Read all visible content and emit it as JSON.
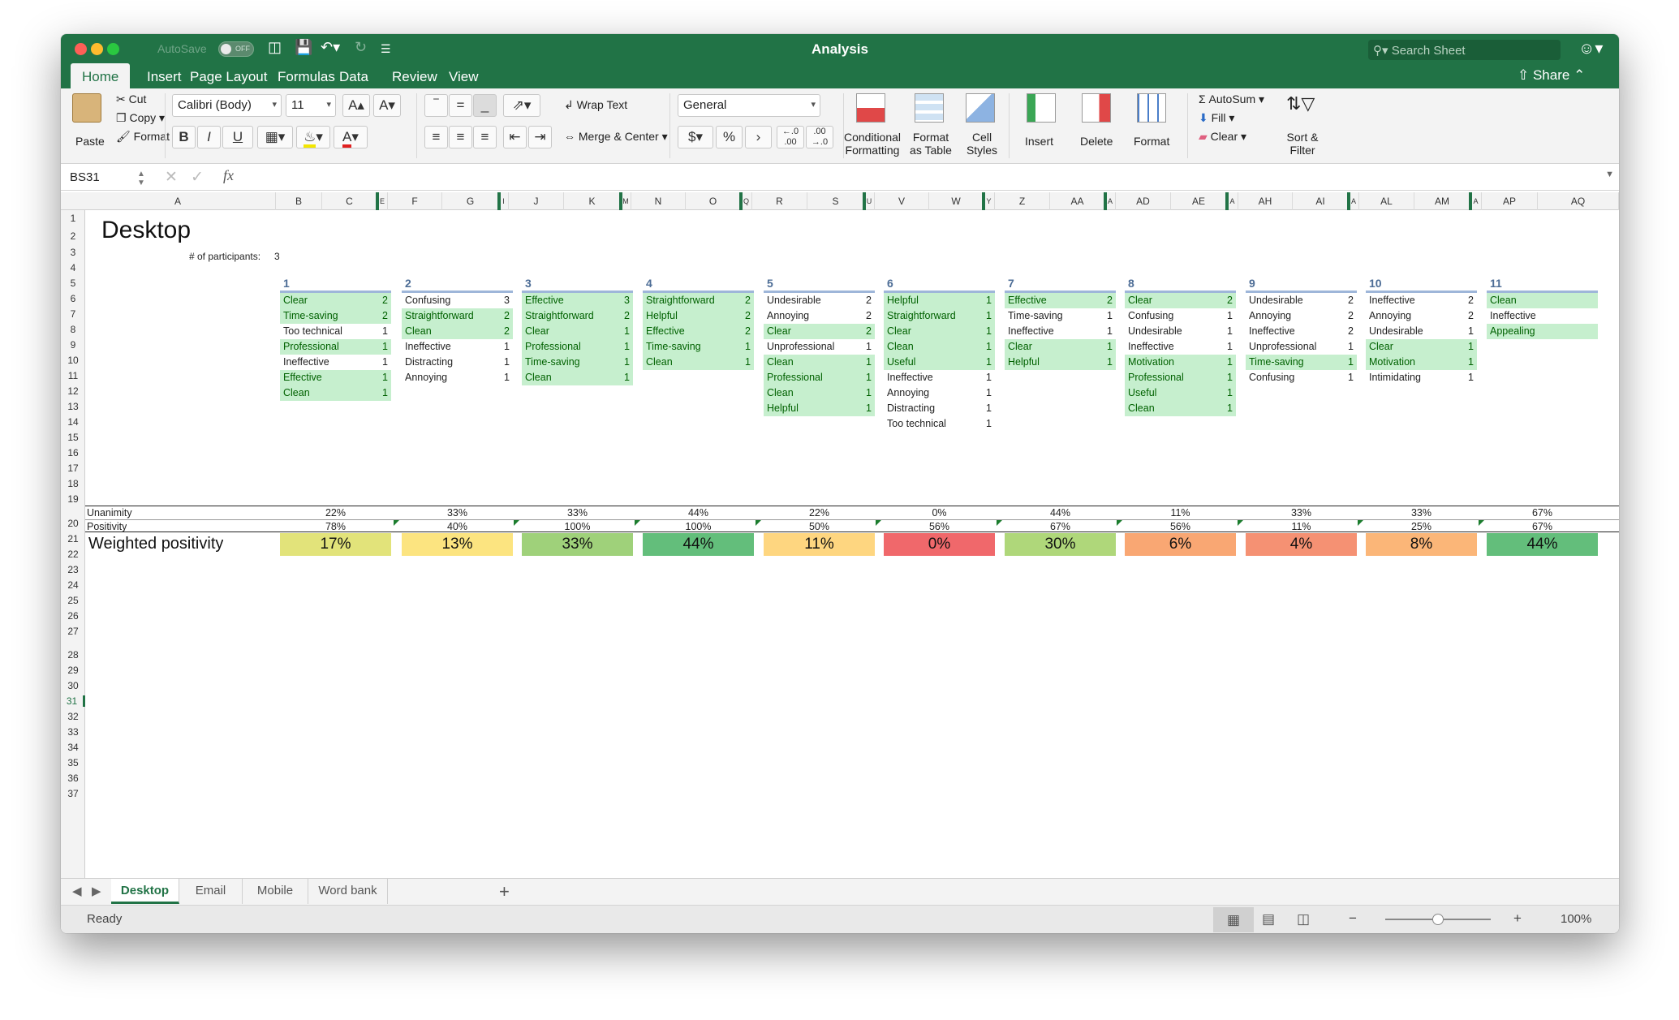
{
  "window": {
    "title": "Analysis",
    "autosave_label": "AutoSave",
    "autosave_state": "OFF",
    "search_placeholder": "Search Sheet",
    "share_label": "Share"
  },
  "ribbon": {
    "tabs": [
      "Home",
      "Insert",
      "Page Layout",
      "Formulas",
      "Data",
      "Review",
      "View"
    ],
    "active_tab": "Home",
    "clipboard": {
      "paste": "Paste",
      "cut": "Cut",
      "copy": "Copy",
      "format": "Format"
    },
    "font": {
      "name": "Calibri (Body)",
      "size": "11",
      "bold": "B",
      "italic": "I",
      "underline": "U"
    },
    "alignment": {
      "wrap_text": "Wrap Text",
      "merge_center": "Merge & Center"
    },
    "number": {
      "format": "General",
      "currency": "$",
      "percent": "%",
      "comma": "›",
      "inc_decimal": "←.0 .00",
      "dec_decimal": ".00 →.0"
    },
    "styles": {
      "conditional": "Conditional Formatting",
      "format_table": "Format as Table",
      "cell_styles": "Cell Styles"
    },
    "cells": {
      "insert": "Insert",
      "delete": "Delete",
      "format": "Format"
    },
    "editing": {
      "autosum": "AutoSum",
      "fill": "Fill",
      "clear": "Clear",
      "sort_filter": "Sort & Filter"
    }
  },
  "formula_bar": {
    "name_box": "BS31",
    "fx": "fx",
    "content": ""
  },
  "columns": [
    "A",
    "B",
    "C",
    "E",
    "F",
    "G",
    "I",
    "J",
    "K",
    "M",
    "N",
    "O",
    "Q",
    "R",
    "S",
    "U",
    "V",
    "W",
    "Y",
    "Z",
    "AA",
    "A",
    "AD",
    "AE",
    "A",
    "AH",
    "AI",
    "A",
    "AL",
    "AM",
    "A",
    "AP",
    "AQ"
  ],
  "rows": [
    "1",
    "2",
    "3",
    "4",
    "5",
    "6",
    "7",
    "8",
    "9",
    "10",
    "11",
    "12",
    "13",
    "14",
    "15",
    "16",
    "17",
    "18",
    "19",
    "20",
    "21",
    "22",
    "23",
    "24",
    "25",
    "26",
    "27",
    "28",
    "29",
    "30",
    "31",
    "32",
    "33",
    "34",
    "35",
    "36",
    "37"
  ],
  "selected_row": "31",
  "sheet": {
    "title": "Desktop",
    "participants_label": "# of participants:",
    "participants_value": "3",
    "unanimity_label": "Unanimity",
    "positivity_label": "Positivity",
    "weighted_label": "Weighted positivity",
    "blocks": [
      {
        "num": "1",
        "words": [
          {
            "w": "Clear",
            "n": "2",
            "pos": true
          },
          {
            "w": "Time-saving",
            "n": "2",
            "pos": true
          },
          {
            "w": "Too technical",
            "n": "1",
            "pos": false
          },
          {
            "w": "Professional",
            "n": "1",
            "pos": true
          },
          {
            "w": "Ineffective",
            "n": "1",
            "pos": false
          },
          {
            "w": "Effective",
            "n": "1",
            "pos": true
          },
          {
            "w": "Clean",
            "n": "1",
            "pos": true
          }
        ],
        "unanimity": "22%",
        "positivity": "78%",
        "weighted": "17%",
        "color": "#e2e37a"
      },
      {
        "num": "2",
        "words": [
          {
            "w": "Confusing",
            "n": "3",
            "pos": false
          },
          {
            "w": "Straightforward",
            "n": "2",
            "pos": true
          },
          {
            "w": "Clean",
            "n": "2",
            "pos": true
          },
          {
            "w": "Ineffective",
            "n": "1",
            "pos": false
          },
          {
            "w": "Distracting",
            "n": "1",
            "pos": false
          },
          {
            "w": "Annoying",
            "n": "1",
            "pos": false
          }
        ],
        "unanimity": "33%",
        "positivity": "40%",
        "weighted": "13%",
        "color": "#fce480"
      },
      {
        "num": "3",
        "words": [
          {
            "w": "Effective",
            "n": "3",
            "pos": true
          },
          {
            "w": "Straightforward",
            "n": "2",
            "pos": true
          },
          {
            "w": "Clear",
            "n": "1",
            "pos": true
          },
          {
            "w": "Professional",
            "n": "1",
            "pos": true
          },
          {
            "w": "Time-saving",
            "n": "1",
            "pos": true
          },
          {
            "w": "Clean",
            "n": "1",
            "pos": true
          }
        ],
        "unanimity": "33%",
        "positivity": "100%",
        "weighted": "33%",
        "color": "#9fd17a"
      },
      {
        "num": "4",
        "words": [
          {
            "w": "Straightforward",
            "n": "2",
            "pos": true
          },
          {
            "w": "Helpful",
            "n": "2",
            "pos": true
          },
          {
            "w": "Effective",
            "n": "2",
            "pos": true
          },
          {
            "w": "Time-saving",
            "n": "1",
            "pos": true
          },
          {
            "w": "Clean",
            "n": "1",
            "pos": true
          }
        ],
        "unanimity": "44%",
        "positivity": "100%",
        "weighted": "44%",
        "color": "#63be7b"
      },
      {
        "num": "5",
        "words": [
          {
            "w": "Undesirable",
            "n": "2",
            "pos": false
          },
          {
            "w": "Annoying",
            "n": "2",
            "pos": false
          },
          {
            "w": "Clear",
            "n": "2",
            "pos": true
          },
          {
            "w": "Unprofessional",
            "n": "1",
            "pos": false
          },
          {
            "w": "Clean",
            "n": "1",
            "pos": true
          },
          {
            "w": "Professional",
            "n": "1",
            "pos": true
          },
          {
            "w": "Clean",
            "n": "1",
            "pos": true
          },
          {
            "w": "Helpful",
            "n": "1",
            "pos": true
          }
        ],
        "unanimity": "22%",
        "positivity": "50%",
        "weighted": "11%",
        "color": "#fed680"
      },
      {
        "num": "6",
        "words": [
          {
            "w": "Helpful",
            "n": "1",
            "pos": true
          },
          {
            "w": "Straightforward",
            "n": "1",
            "pos": true
          },
          {
            "w": "Clear",
            "n": "1",
            "pos": true
          },
          {
            "w": "Clean",
            "n": "1",
            "pos": true
          },
          {
            "w": "Useful",
            "n": "1",
            "pos": true
          },
          {
            "w": "Ineffective",
            "n": "1",
            "pos": false
          },
          {
            "w": "Annoying",
            "n": "1",
            "pos": false
          },
          {
            "w": "Distracting",
            "n": "1",
            "pos": false
          },
          {
            "w": "Too technical",
            "n": "1",
            "pos": false
          }
        ],
        "unanimity": "0%",
        "positivity": "56%",
        "weighted": "0%",
        "color": "#f0686b"
      },
      {
        "num": "7",
        "words": [
          {
            "w": "Effective",
            "n": "2",
            "pos": true
          },
          {
            "w": "Time-saving",
            "n": "1",
            "pos": false
          },
          {
            "w": "Ineffective",
            "n": "1",
            "pos": false
          },
          {
            "w": "Clear",
            "n": "1",
            "pos": true
          },
          {
            "w": "Helpful",
            "n": "1",
            "pos": true
          }
        ],
        "unanimity": "44%",
        "positivity": "67%",
        "weighted": "30%",
        "color": "#afd77a"
      },
      {
        "num": "8",
        "words": [
          {
            "w": "Clear",
            "n": "2",
            "pos": true
          },
          {
            "w": "Confusing",
            "n": "1",
            "pos": false
          },
          {
            "w": "Undesirable",
            "n": "1",
            "pos": false
          },
          {
            "w": "Ineffective",
            "n": "1",
            "pos": false
          },
          {
            "w": "Motivation",
            "n": "1",
            "pos": true
          },
          {
            "w": "Professional",
            "n": "1",
            "pos": true
          },
          {
            "w": "Useful",
            "n": "1",
            "pos": true
          },
          {
            "w": "Clean",
            "n": "1",
            "pos": true
          }
        ],
        "unanimity": "11%",
        "positivity": "56%",
        "weighted": "6%",
        "color": "#f9a773"
      },
      {
        "num": "9",
        "words": [
          {
            "w": "Undesirable",
            "n": "2",
            "pos": false
          },
          {
            "w": "Annoying",
            "n": "2",
            "pos": false
          },
          {
            "w": "Ineffective",
            "n": "2",
            "pos": false
          },
          {
            "w": "Unprofessional",
            "n": "1",
            "pos": false
          },
          {
            "w": "Time-saving",
            "n": "1",
            "pos": true
          },
          {
            "w": "Confusing",
            "n": "1",
            "pos": false
          }
        ],
        "unanimity": "33%",
        "positivity": "11%",
        "weighted": "4%",
        "color": "#f59173"
      },
      {
        "num": "10",
        "words": [
          {
            "w": "Ineffective",
            "n": "2",
            "pos": false
          },
          {
            "w": "Annoying",
            "n": "2",
            "pos": false
          },
          {
            "w": "Undesirable",
            "n": "1",
            "pos": false
          },
          {
            "w": "Clear",
            "n": "1",
            "pos": true
          },
          {
            "w": "Motivation",
            "n": "1",
            "pos": true
          },
          {
            "w": "Intimidating",
            "n": "1",
            "pos": false
          }
        ],
        "unanimity": "33%",
        "positivity": "25%",
        "weighted": "8%",
        "color": "#fbb678"
      },
      {
        "num": "11",
        "words": [
          {
            "w": "Clean",
            "n": "",
            "pos": true
          },
          {
            "w": "Ineffective",
            "n": "",
            "pos": false
          },
          {
            "w": "Appealing",
            "n": "",
            "pos": true
          }
        ],
        "unanimity": "67%",
        "positivity": "67%",
        "weighted": "44%",
        "color": "#63be7b"
      }
    ]
  },
  "sheet_tabs": [
    "Desktop",
    "Email",
    "Mobile",
    "Word bank"
  ],
  "active_sheet": "Desktop",
  "status": {
    "ready": "Ready",
    "zoom": "100%",
    "zoom_minus": "−",
    "zoom_plus": "+",
    "zoom_level": 0.5
  },
  "colors": {
    "excel_green": "#217346",
    "positive_fill": "#c6efce",
    "positive_text": "#006100"
  }
}
